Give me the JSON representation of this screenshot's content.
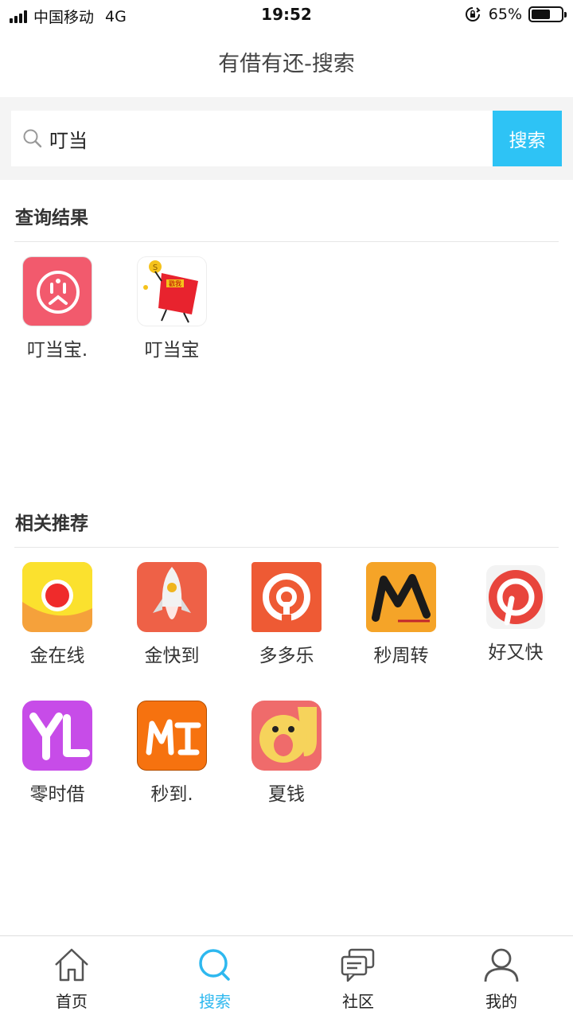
{
  "status_bar": {
    "carrier": "中国移动",
    "network": "4G",
    "time": "19:52",
    "battery": "65%",
    "battery_level": 0.65
  },
  "header": {
    "title": "有借有还-搜索"
  },
  "search": {
    "value": "叮当",
    "button_label": "搜索"
  },
  "results": {
    "title": "查询结果",
    "apps": [
      {
        "name": "叮当宝.",
        "icon": "dingdangbao-face-icon"
      },
      {
        "name": "叮当宝",
        "icon": "red-envelope-mascot-icon"
      }
    ]
  },
  "recommend": {
    "title": "相关推荐",
    "apps": [
      {
        "name": "金在线",
        "icon": "jinzaixian-icon"
      },
      {
        "name": "金快到",
        "icon": "rocket-icon"
      },
      {
        "name": "多多乐",
        "icon": "duoduole-icon"
      },
      {
        "name": "秒周转",
        "icon": "m-letter-icon"
      },
      {
        "name": "好又快",
        "icon": "pinterest-p-icon"
      },
      {
        "name": "零时借",
        "icon": "yl-letters-icon"
      },
      {
        "name": "秒到.",
        "icon": "mt-letters-icon"
      },
      {
        "name": "夏钱",
        "icon": "a-mascot-icon"
      }
    ]
  },
  "tabbar": {
    "tabs": [
      {
        "label": "首页",
        "icon": "home-icon"
      },
      {
        "label": "搜索",
        "icon": "search-icon",
        "active": true
      },
      {
        "label": "社区",
        "icon": "chat-bubbles-icon"
      },
      {
        "label": "我的",
        "icon": "user-icon"
      }
    ]
  },
  "colors": {
    "accent": "#2ec3f5",
    "active_tab": "#2eb8ef"
  }
}
